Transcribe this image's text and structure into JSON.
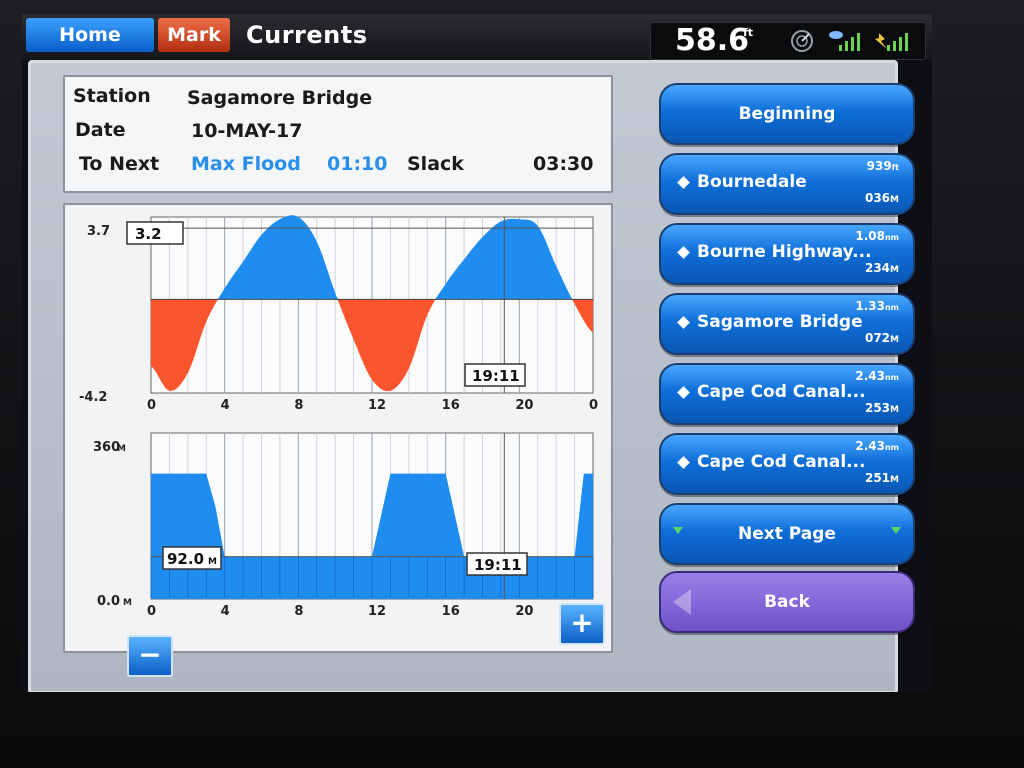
{
  "topbar": {
    "home_label": "Home",
    "mark_label": "Mark",
    "title": "Currents",
    "depth_value": "58.6",
    "depth_unit": "ft"
  },
  "info": {
    "station_label": "Station",
    "station_value": "Sagamore Bridge",
    "date_label": "Date",
    "date_value": "10-MAY-17",
    "next_label": "To Next",
    "next_event": "Max Flood",
    "next_event_time": "01:10",
    "slack_label": "Slack",
    "slack_time": "03:30"
  },
  "speed_chart": {
    "y_max_label": "3.7",
    "y_min_label": "-4.2",
    "cursor_value": "3.2",
    "cursor_time": "19:11",
    "x_ticks": [
      "0",
      "4",
      "8",
      "12",
      "16",
      "20",
      "0"
    ]
  },
  "dir_chart": {
    "y_max_label": "360",
    "y_min_label": "0.0",
    "y_unit": "M",
    "cursor_value": "92.0",
    "cursor_time": "19:11",
    "x_ticks": [
      "0",
      "4",
      "8",
      "12",
      "16",
      "20",
      "0"
    ]
  },
  "chart_data": [
    {
      "type": "area",
      "title": "",
      "xlabel": "",
      "ylabel": "",
      "xlim": [
        0,
        24
      ],
      "ylim": [
        -4.2,
        3.7
      ],
      "x": [
        0,
        1,
        2,
        3,
        4,
        5,
        6,
        7,
        8,
        9,
        10,
        11,
        12,
        13,
        14,
        15,
        16,
        17,
        18,
        19,
        20,
        21,
        22,
        23,
        24
      ],
      "y": [
        -3.0,
        -4.1,
        -3.3,
        -1.0,
        0.5,
        1.7,
        2.9,
        3.6,
        3.7,
        2.6,
        0.3,
        -1.8,
        -3.6,
        -4.1,
        -3.1,
        -0.7,
        0.7,
        1.8,
        2.8,
        3.5,
        3.6,
        3.3,
        1.5,
        -0.2,
        -1.5
      ],
      "colors": {
        "flood": "#1f8cf0",
        "ebb": "#fa552c"
      },
      "grid": true
    },
    {
      "type": "area",
      "title": "",
      "xlabel": "",
      "ylabel": "",
      "xlim": [
        0,
        24
      ],
      "ylim": [
        0,
        360
      ],
      "x": [
        0,
        1,
        2,
        3,
        3.5,
        4,
        5,
        6,
        7,
        8,
        9,
        10,
        11,
        12,
        13,
        14,
        15,
        16,
        17,
        18,
        19,
        20,
        21,
        22,
        23,
        23.5,
        24
      ],
      "y": [
        272,
        272,
        272,
        272,
        200,
        92,
        92,
        92,
        92,
        92,
        92,
        92,
        92,
        92,
        272,
        272,
        272,
        272,
        92,
        92,
        92,
        92,
        92,
        92,
        92,
        272,
        272
      ],
      "colors": {
        "fill": "#1f8cf0"
      },
      "grid": true
    }
  ],
  "waypoints": {
    "beginning_label": "Beginning",
    "items": [
      {
        "name": "Bournedale",
        "dist": "939",
        "dist_unit": "ft",
        "brg": "036",
        "brg_unit": "M"
      },
      {
        "name": "Bourne Highway...",
        "dist": "1.08",
        "dist_unit": "nm",
        "brg": "234",
        "brg_unit": "M"
      },
      {
        "name": "Sagamore Bridge",
        "dist": "1.33",
        "dist_unit": "nm",
        "brg": "072",
        "brg_unit": "M"
      },
      {
        "name": "Cape Cod Canal...",
        "dist": "2.43",
        "dist_unit": "nm",
        "brg": "253",
        "brg_unit": "M"
      },
      {
        "name": "Cape Cod Canal...",
        "dist": "2.43",
        "dist_unit": "nm",
        "brg": "251",
        "brg_unit": "M"
      }
    ],
    "next_page_label": "Next Page",
    "back_label": "Back"
  },
  "zoom": {
    "minus": "−",
    "plus": "+"
  }
}
